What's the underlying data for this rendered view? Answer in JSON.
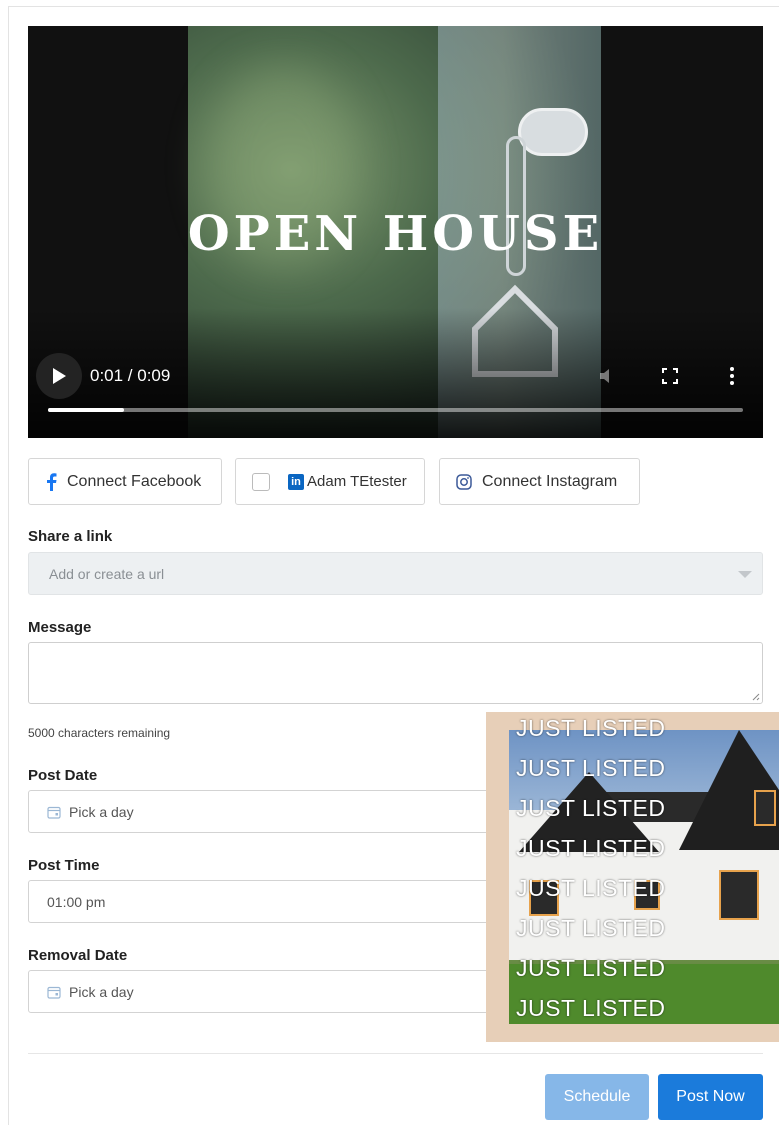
{
  "video": {
    "title": "OPEN HOUSE",
    "time": "0:01 / 0:09",
    "progress": 0.11
  },
  "social": {
    "facebook_label": "Connect Facebook",
    "linkedin_badge": "in",
    "linkedin_label": "Adam TEtester",
    "instagram_label": "Connect Instagram"
  },
  "link": {
    "label": "Share a link",
    "placeholder": "Add or create a url"
  },
  "message": {
    "label": "Message",
    "remaining": "5000 characters remaining"
  },
  "post_date": {
    "label": "Post Date",
    "placeholder": "Pick a day"
  },
  "post_time": {
    "label": "Post Time",
    "value": "01:00 pm"
  },
  "removal_date": {
    "label": "Removal Date",
    "placeholder": "Pick a day"
  },
  "buttons": {
    "schedule": "Schedule",
    "post_now": "Post Now"
  },
  "overlay": {
    "lines": [
      "JUST LISTED",
      "JUST LISTED",
      "JUST LISTED",
      "JUST LISTED",
      "JUST LISTED",
      "JUST LISTED",
      "JUST LISTED",
      "JUST LISTED"
    ]
  },
  "colors": {
    "primary": "#1b7bdb",
    "primary_light": "#86b7e8",
    "facebook": "#1877f2",
    "linkedin": "#0a66c2"
  }
}
